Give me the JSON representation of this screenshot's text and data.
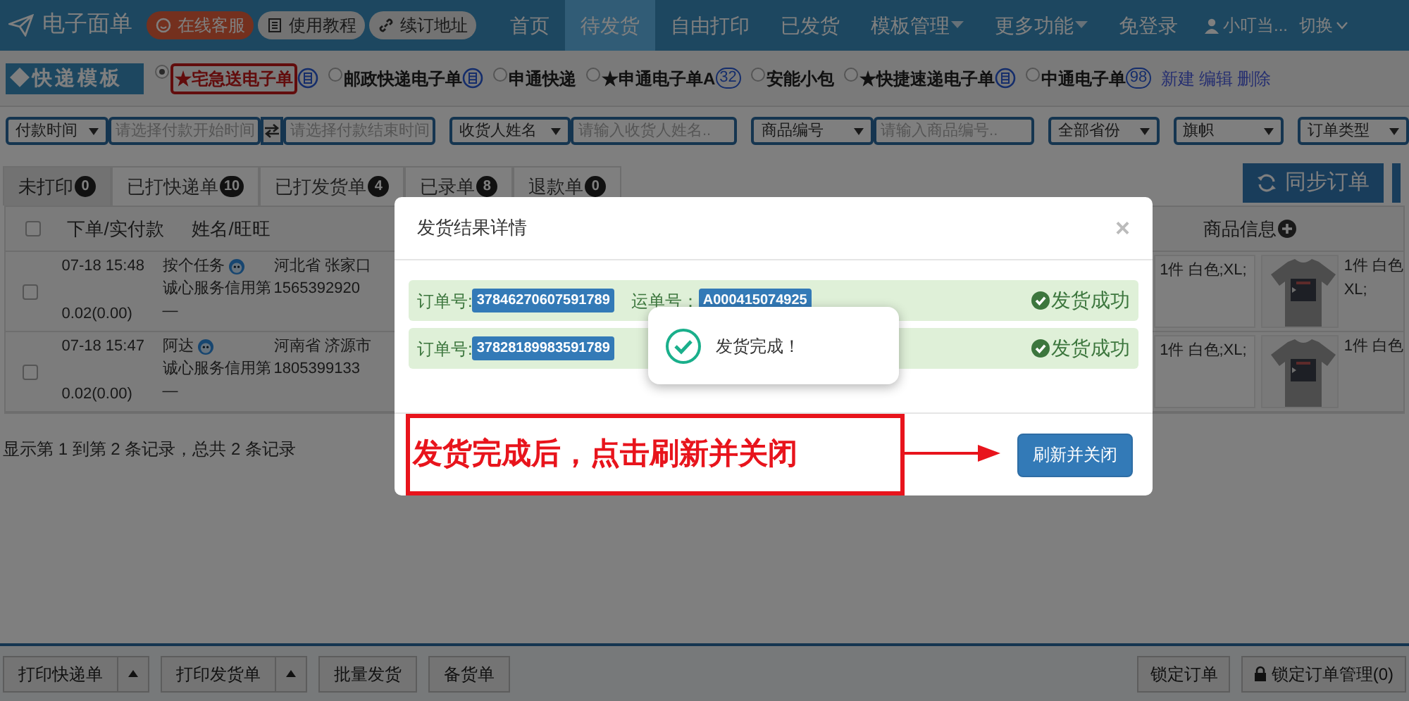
{
  "nav": {
    "title": "电子面单",
    "pills": [
      {
        "label": "在线客服",
        "kind": "service"
      },
      {
        "label": "使用教程",
        "kind": "guide"
      },
      {
        "label": "续订地址",
        "kind": "link"
      }
    ],
    "items": [
      {
        "label": "首页",
        "selected": false,
        "dropdown": false
      },
      {
        "label": "待发货",
        "selected": true,
        "dropdown": false
      },
      {
        "label": "自由打印",
        "selected": false,
        "dropdown": false
      },
      {
        "label": "已发货",
        "selected": false,
        "dropdown": false
      },
      {
        "label": "模板管理",
        "selected": false,
        "dropdown": true
      },
      {
        "label": "更多功能",
        "selected": false,
        "dropdown": true
      },
      {
        "label": "免登录",
        "selected": false,
        "dropdown": false
      }
    ],
    "user": "小叮当...",
    "switch": "切换"
  },
  "templates": {
    "label": "◆快递模板",
    "options": [
      {
        "label": "★宅急送电子单",
        "selected": true,
        "kind": "icon"
      },
      {
        "label": "邮政快递电子单",
        "selected": false,
        "kind": "icon"
      },
      {
        "label": "申通快递",
        "selected": false,
        "kind": "plain"
      },
      {
        "label": "★申通电子单A",
        "selected": false,
        "kind": "count",
        "count": "32"
      },
      {
        "label": "安能小包",
        "selected": false,
        "kind": "plain"
      },
      {
        "label": "★快捷速递电子单",
        "selected": false,
        "kind": "icon"
      },
      {
        "label": "中通电子单",
        "selected": false,
        "kind": "count",
        "count": "98"
      }
    ],
    "links": [
      "新建",
      "编辑",
      "删除"
    ]
  },
  "filters": [
    {
      "kind": "select",
      "value": "付款时间"
    },
    {
      "kind": "input",
      "placeholder": "请选择付款开始时间"
    },
    {
      "kind": "swap"
    },
    {
      "kind": "input",
      "placeholder": "请选择付款结束时间"
    },
    {
      "kind": "gap"
    },
    {
      "kind": "select",
      "value": "收货人姓名"
    },
    {
      "kind": "input",
      "placeholder": "请输入收货人姓名.."
    },
    {
      "kind": "gap"
    },
    {
      "kind": "select",
      "value": "商品编号"
    },
    {
      "kind": "input",
      "placeholder": "请输入商品编号.."
    },
    {
      "kind": "gap"
    },
    {
      "kind": "select",
      "value": "全部省份"
    },
    {
      "kind": "gap"
    },
    {
      "kind": "select",
      "value": "旗帜"
    },
    {
      "kind": "gap"
    },
    {
      "kind": "select",
      "value": "订单类型"
    }
  ],
  "tabs": [
    {
      "label": "未打印",
      "count": "0",
      "selected": true
    },
    {
      "label": "已打快递单",
      "count": "10",
      "selected": false
    },
    {
      "label": "已打发货单",
      "count": "4",
      "selected": false
    },
    {
      "label": "已录单",
      "count": "8",
      "selected": false
    },
    {
      "label": "退款单",
      "count": "0",
      "selected": false
    }
  ],
  "sync_button": "同步订单",
  "table": {
    "all_checked": false,
    "columns": [
      "下单/实付款",
      "姓名/旺旺",
      "商品信息"
    ],
    "rows": [
      {
        "checked": false,
        "time": "07-18 15:48",
        "amount": "0.02(0.00)",
        "name": "按个任务",
        "credit": "诚心服务信用第",
        "dash": "—",
        "address": "河北省 张家口",
        "phone": "1565392920",
        "item_1": "1件  白色;XL;",
        "item_2": [
          "1件  白色",
          "XL;"
        ]
      },
      {
        "checked": false,
        "time": "07-18 15:47",
        "amount": "0.02(0.00)",
        "name": "阿达",
        "credit": "诚心服务信用第",
        "dash": "—",
        "address": "河南省 济源市",
        "phone": "1805399133",
        "item_1": "1件  白色;XL;",
        "item_2": [
          "1件  白色"
        ]
      }
    ],
    "summary": "显示第 1 到第 2 条记录，总共 2 条记录"
  },
  "bottom_bar": {
    "left": [
      {
        "label": "打印快递单",
        "dropdown": true
      },
      {
        "label": "打印发货单",
        "dropdown": true
      },
      {
        "label": "批量发货",
        "dropdown": false
      },
      {
        "label": "备货单",
        "dropdown": false
      }
    ],
    "right": [
      {
        "label": "锁定订单",
        "lock": false
      },
      {
        "label": "锁定订单管理(0)",
        "lock": true
      }
    ]
  },
  "modal": {
    "title": "发货结果详情",
    "close": "×",
    "results": [
      {
        "order_label": "订单号:",
        "order_no": "37846270607591789",
        "waybill_label": "运单号：",
        "waybill_no": "A000415074925",
        "status": "发货成功"
      },
      {
        "order_label": "订单号:",
        "order_no": "37828189983591789",
        "status": "发货成功"
      }
    ],
    "button": "刷新并关闭"
  },
  "toast": {
    "text": "发货完成！"
  },
  "annotation": {
    "text": "发货完成后，点击刷新并关闭"
  }
}
